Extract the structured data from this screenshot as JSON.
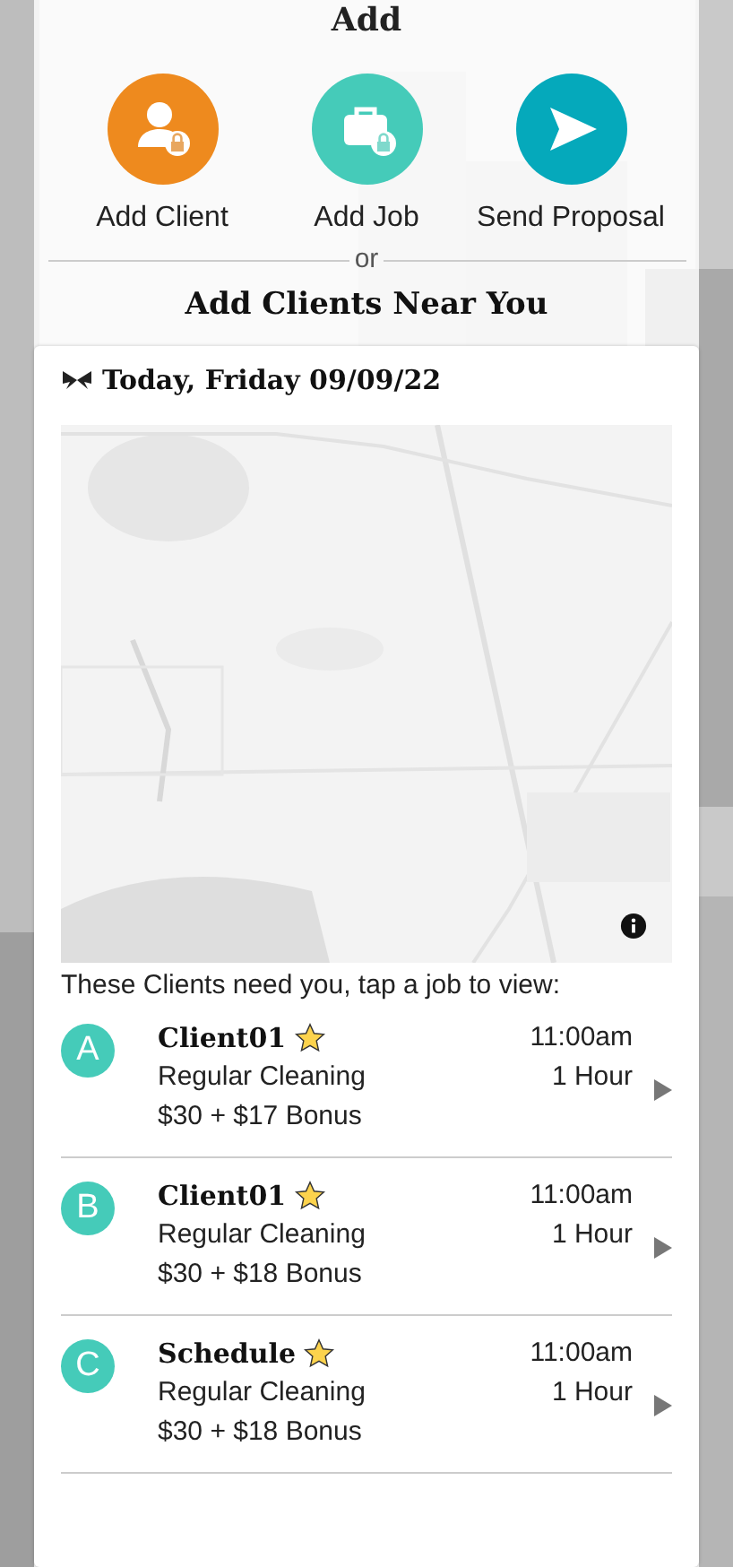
{
  "title": "Add",
  "actions": [
    {
      "kind": "client",
      "label": "Add Client",
      "color": "#ee8a1e"
    },
    {
      "kind": "job",
      "label": "Add Job",
      "color": "#45cbb9"
    },
    {
      "kind": "proposal",
      "label": "Send Proposal",
      "color": "#05a9bb"
    }
  ],
  "divider_text": "or",
  "section_title": "Add Clients Near You",
  "card": {
    "date": "Today, Friday 09/09/22",
    "hint": "These Clients need you, tap a job to view:",
    "jobs": [
      {
        "letter": "A",
        "name": "Client01",
        "service": "Regular Cleaning",
        "pay": "$30 + $17 Bonus",
        "time": "11:00am",
        "duration": "1 Hour"
      },
      {
        "letter": "B",
        "name": "Client01",
        "service": "Regular Cleaning",
        "pay": "$30 + $18 Bonus",
        "time": "11:00am",
        "duration": "1 Hour"
      },
      {
        "letter": "C",
        "name": "Schedule",
        "service": "Regular Cleaning",
        "pay": "$30 + $18 Bonus",
        "time": "11:00am",
        "duration": "1 Hour"
      }
    ]
  }
}
